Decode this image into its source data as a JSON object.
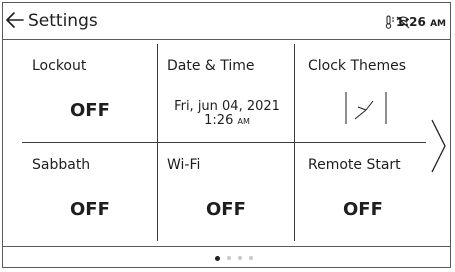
{
  "header": {
    "title": "Settings",
    "back_icon": "arrow-left-icon",
    "status_icons": [
      "thermometer-icon",
      "wifi-icon"
    ],
    "time": "1:26",
    "ampm": "AM"
  },
  "tiles": [
    {
      "label": "Lockout",
      "value": "OFF"
    },
    {
      "label": "Date & Time",
      "date": "Fri, jun 04, 2021",
      "time": "1:26",
      "ampm": "AM"
    },
    {
      "label": "Clock Themes",
      "icon": "analog-clock-icon"
    },
    {
      "label": "Sabbath",
      "value": "OFF"
    },
    {
      "label": "Wi-Fi",
      "value": "OFF"
    },
    {
      "label": "Remote Start",
      "value": "OFF"
    }
  ],
  "navigation": {
    "next_icon": "chevron-right-icon",
    "page_count": 4,
    "current_page": 1
  },
  "colors": {
    "text": "#1e1e1e",
    "border": "#5a5a5a",
    "dot_active": "#222222",
    "dot_inactive": "#c8c8c8"
  }
}
